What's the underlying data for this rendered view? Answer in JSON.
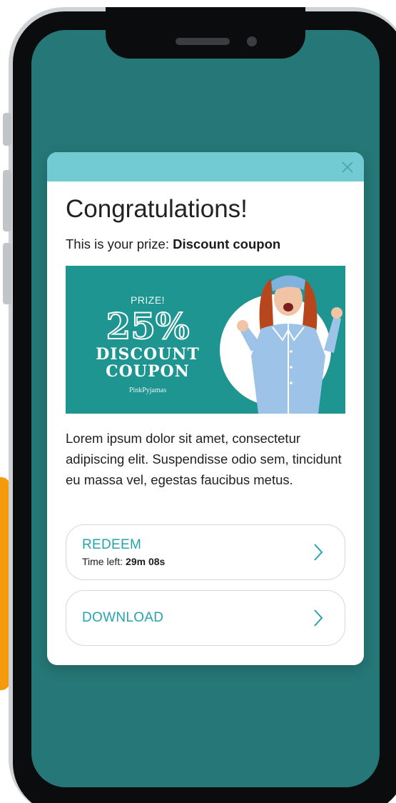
{
  "modal": {
    "title": "Congratulations!",
    "prize_prefix": "This is your prize:",
    "prize_name": "Discount coupon",
    "close_icon": "close-icon",
    "body": "Lorem ipsum dolor sit amet, consectetur adipiscing elit. Suspendisse odio sem, tincidunt eu massa vel, egestas faucibus metus."
  },
  "banner": {
    "prize_label": "PRIZE!",
    "percent": "25%",
    "line1": "DISCOUNT",
    "line2": "COUPON",
    "brand": "PinkPyjamas"
  },
  "actions": {
    "redeem_label": "REDEEM",
    "time_left_label": "Time left:",
    "time_left_value": "29m 08s",
    "download_label": "DOWNLOAD"
  },
  "colors": {
    "screen_bg": "#257877",
    "accent": "#72cbd3",
    "link": "#26a3ab",
    "banner_bg": "#1f9592"
  }
}
